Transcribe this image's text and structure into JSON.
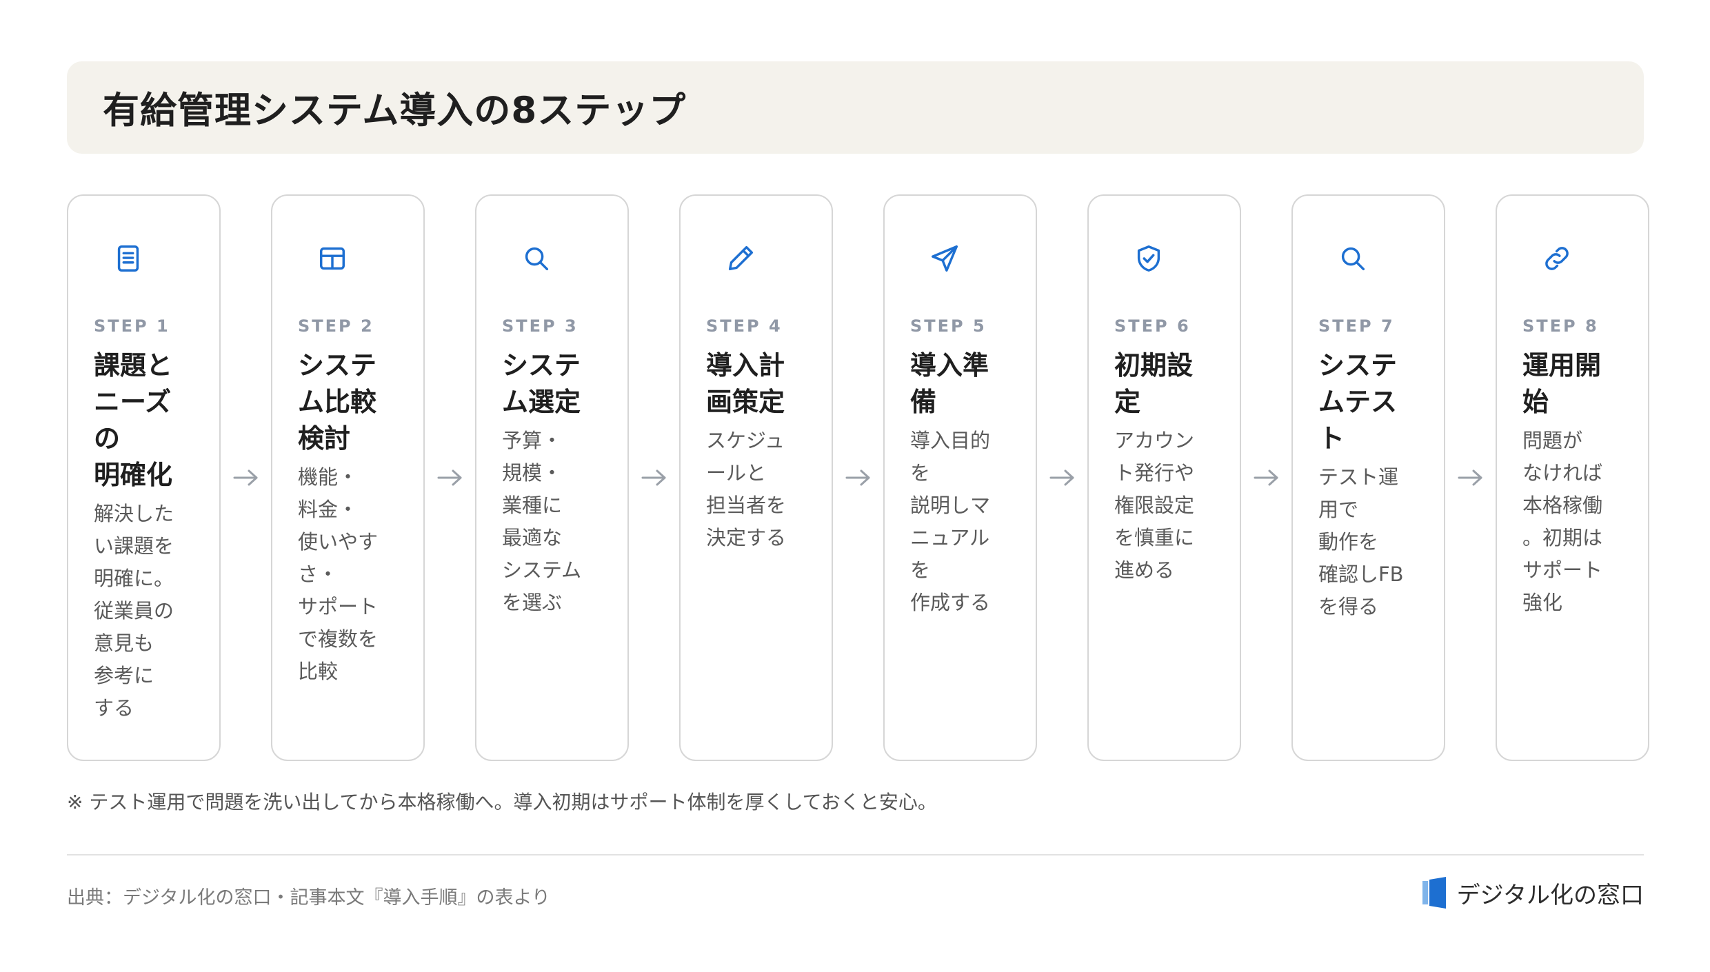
{
  "header": {
    "title": "有給管理システム導入の8ステップ"
  },
  "steps": [
    {
      "icon": "document-icon",
      "label": "STEP 1",
      "title": "課題と\nニーズ\nの\n明確化",
      "desc": "解決した\nい課題を\n明確に。\n従業員の\n意見も\n参考に\nする"
    },
    {
      "icon": "table-icon",
      "label": "STEP 2",
      "title": "システ\nム比較\n検討",
      "desc": "機能・\n料金・\n使いやす\nさ・\nサポート\nで複数を\n比較"
    },
    {
      "icon": "search-icon",
      "label": "STEP 3",
      "title": "システ\nム選定",
      "desc": "予算・\n規模・\n業種に\n最適な\nシステム\nを選ぶ"
    },
    {
      "icon": "pencil-icon",
      "label": "STEP 4",
      "title": "導入計\n画策定",
      "desc": "スケジュ\nールと\n担当者を\n決定する"
    },
    {
      "icon": "send-icon",
      "label": "STEP 5",
      "title": "導入準\n備",
      "desc": "導入目的\nを\n説明しマ\nニュアル\nを\n作成する"
    },
    {
      "icon": "shield-check-icon",
      "label": "STEP 6",
      "title": "初期設\n定",
      "desc": "アカウン\nト発行や\n権限設定\nを慎重に\n進める"
    },
    {
      "icon": "search-icon",
      "label": "STEP 7",
      "title": "システ\nムテス\nト",
      "desc": "テスト運\n用で\n動作を\n確認しFB\nを得る"
    },
    {
      "icon": "link-icon",
      "label": "STEP 8",
      "title": "運用開\n始",
      "desc": "問題が\nなければ\n本格稼働\n。初期は\nサポート\n強化"
    }
  ],
  "note": "※ テスト運用で問題を洗い出してから本格稼働へ。導入初期はサポート体制を厚くしておくと安心。",
  "footer": {
    "source": "出典：デジタル化の窓口・記事本文『導入手順』の表より",
    "brand": "デジタル化の窓口"
  },
  "colors": {
    "accent": "#1d6fd1",
    "header_bg": "#f4f2ec",
    "step_label": "#9098a6"
  }
}
